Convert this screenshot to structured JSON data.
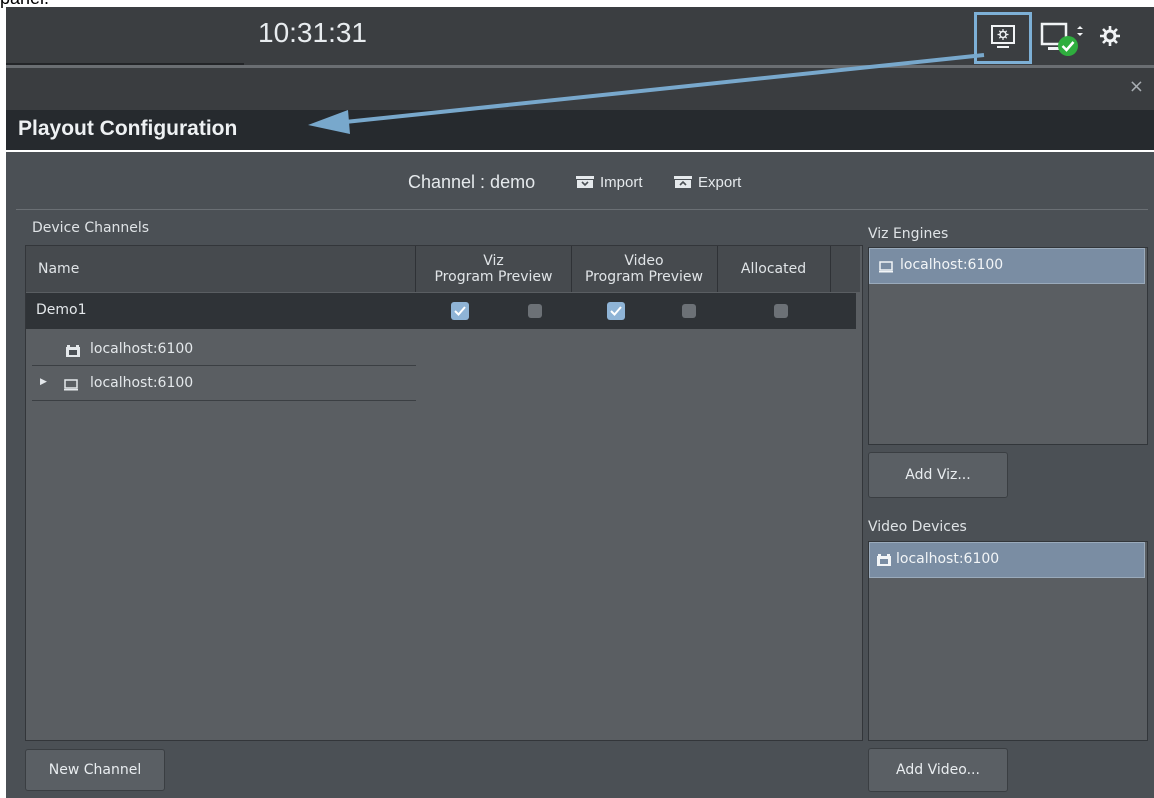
{
  "caption": "panel.",
  "topbar": {
    "clock": "10:31:31",
    "icons": [
      "playout-config-icon",
      "monitor-check-icon",
      "settings-icon"
    ]
  },
  "close_label": "×",
  "title": "Playout Configuration",
  "channel": {
    "label": "Channel : demo",
    "import_label": "Import",
    "export_label": "Export"
  },
  "device_channels": {
    "heading": "Device Channels",
    "columns": {
      "name": "Name",
      "viz_top": "Viz",
      "viz_sub": "Program Preview",
      "video_top": "Video",
      "video_sub": "Program Preview",
      "allocated": "Allocated"
    },
    "rows": [
      {
        "name": "Demo1",
        "viz_program": true,
        "viz_preview": false,
        "video_program": true,
        "video_preview": false,
        "allocated": false
      }
    ],
    "children": [
      {
        "icon": "video-device-icon",
        "label": "localhost:6100"
      },
      {
        "icon": "monitor-icon",
        "label": "localhost:6100"
      }
    ],
    "new_channel_label": "New Channel"
  },
  "viz_engines": {
    "heading": "Viz Engines",
    "items": [
      "localhost:6100"
    ],
    "add_label": "Add Viz..."
  },
  "video_devices": {
    "heading": "Video Devices",
    "items": [
      "localhost:6100"
    ],
    "add_label": "Add Video..."
  },
  "colors": {
    "accent_highlight": "#7db0d6",
    "checkbox_on": "#8fb4d6",
    "selection": "#7a8da3"
  }
}
